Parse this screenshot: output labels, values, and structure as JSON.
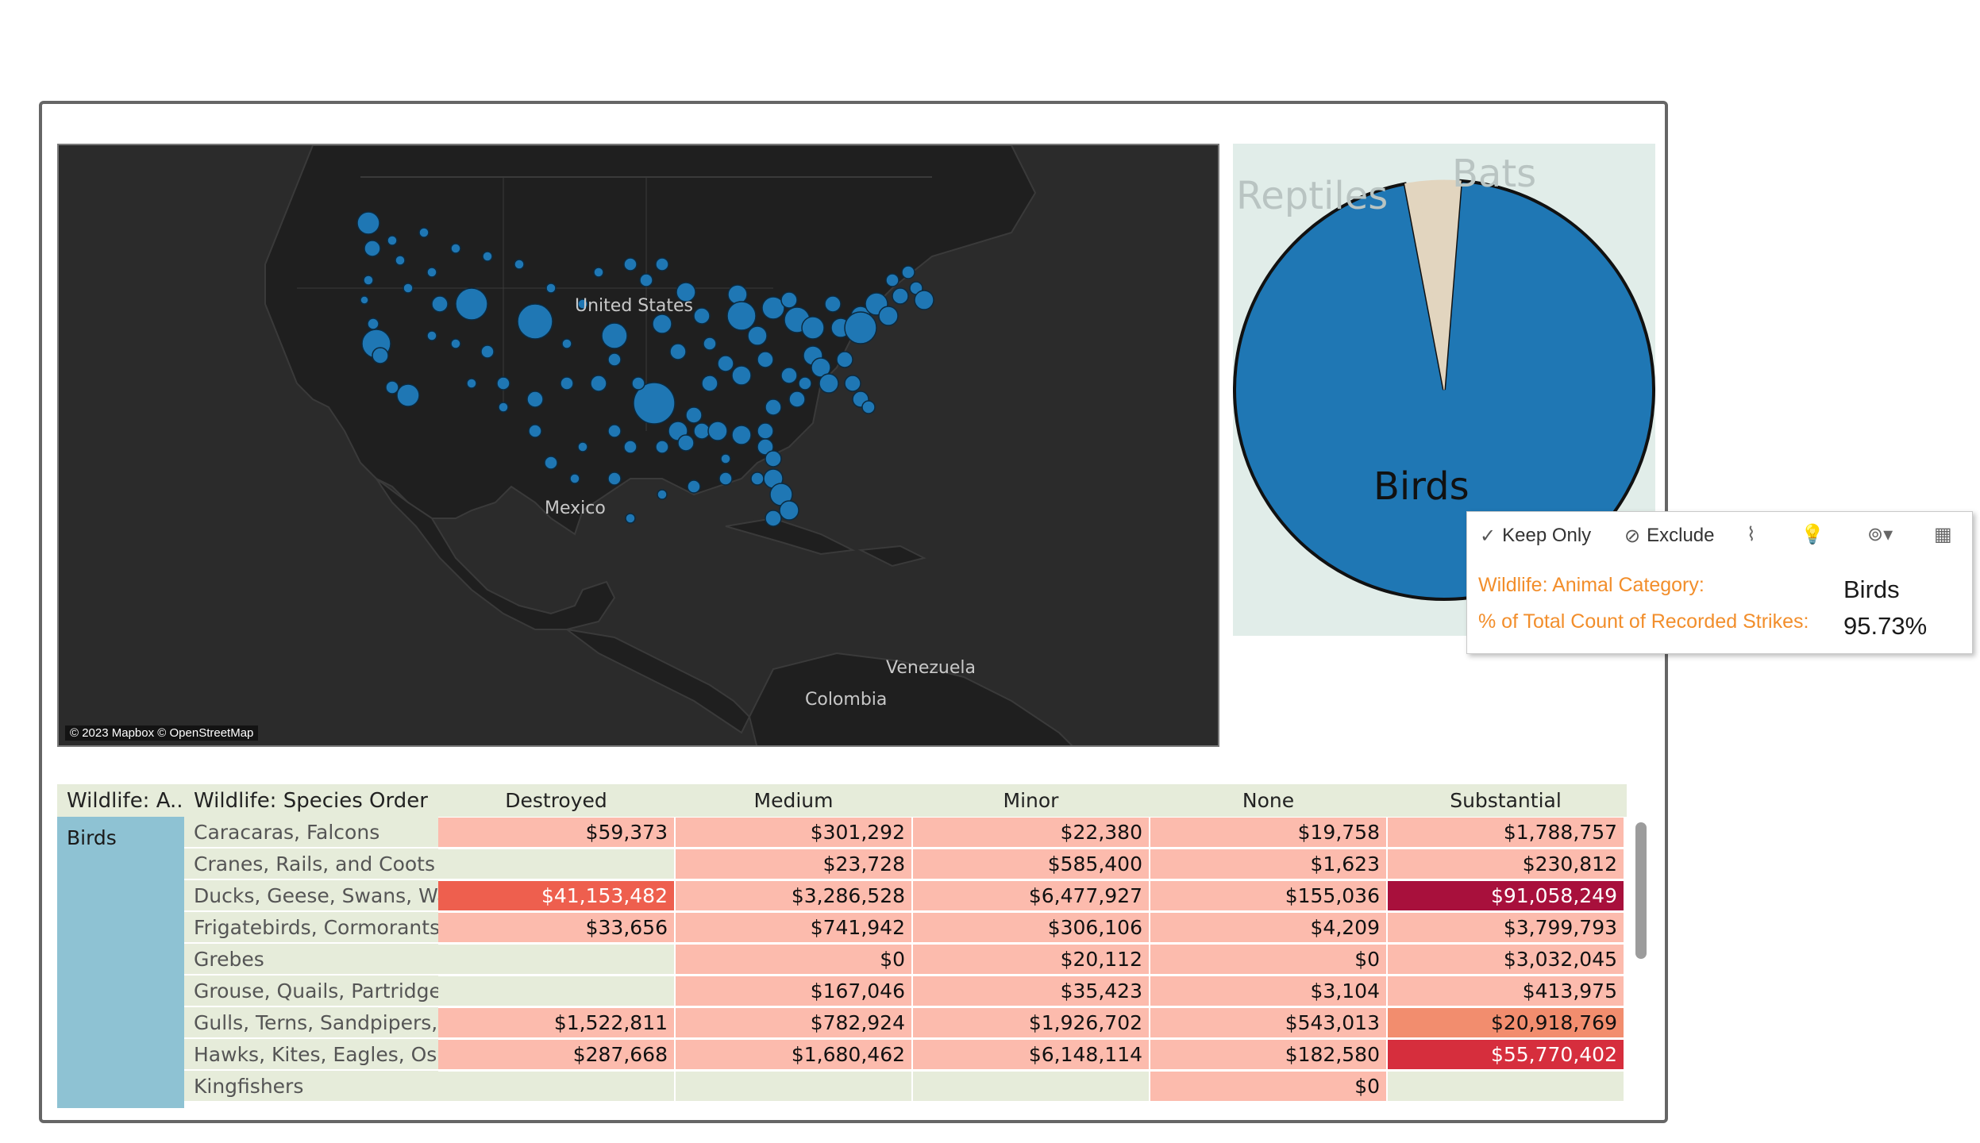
{
  "map": {
    "labels": [
      "United States",
      "Mexico",
      "Venezuela",
      "Colombia"
    ],
    "attribution": "© 2023 Mapbox © OpenStreetMap",
    "point_color": "#1f77b4"
  },
  "pie": {
    "slices": [
      {
        "label": "Birds",
        "percent": 95.73,
        "color": "#1f77b4"
      },
      {
        "label": "Bats",
        "percent": 3.2,
        "color": "#e2d5bf"
      },
      {
        "label": "Reptiles",
        "percent": 1.07,
        "color": "#e2d5bf"
      }
    ]
  },
  "tooltip": {
    "keep_only": "Keep Only",
    "exclude": "Exclude",
    "field1_label": "Wildlife: Animal Category:",
    "field1_value": "Birds",
    "field2_label": "% of Total Count of Recorded Strikes:",
    "field2_value": "95.73%"
  },
  "table": {
    "headers": {
      "col1": "Wildlife: A..",
      "col2": "Wildlife: Species Order",
      "damage": [
        "Destroyed",
        "Medium",
        "Minor",
        "None",
        "Substantial"
      ]
    },
    "category": "Birds",
    "rows": [
      {
        "order": "Caracaras, Falcons",
        "values": [
          "$59,373",
          "$301,292",
          "$22,380",
          "$19,758",
          "$1,788,757"
        ]
      },
      {
        "order": "Cranes, Rails, and Coots",
        "values": [
          "",
          "$23,728",
          "$585,400",
          "$1,623",
          "$230,812"
        ]
      },
      {
        "order": "Ducks, Geese, Swans, Wa..",
        "values": [
          "$41,153,482",
          "$3,286,528",
          "$6,477,927",
          "$155,036",
          "$91,058,249"
        ]
      },
      {
        "order": "Frigatebirds, Cormorants,..",
        "values": [
          "$33,656",
          "$741,942",
          "$306,106",
          "$4,209",
          "$3,799,793"
        ]
      },
      {
        "order": "Grebes",
        "values": [
          "",
          "$0",
          "$20,112",
          "$0",
          "$3,032,045"
        ]
      },
      {
        "order": "Grouse, Quails, Partridge..",
        "values": [
          "",
          "$167,046",
          "$35,423",
          "$3,104",
          "$413,975"
        ]
      },
      {
        "order": "Gulls, Terns, Sandpipers, ..",
        "values": [
          "$1,522,811",
          "$782,924",
          "$1,926,702",
          "$543,013",
          "$20,918,769"
        ]
      },
      {
        "order": "Hawks, Kites, Eagles, Osp..",
        "values": [
          "$287,668",
          "$1,680,462",
          "$6,148,114",
          "$182,580",
          "$55,770,402"
        ]
      },
      {
        "order": "Kingfishers",
        "values": [
          "",
          "",
          "",
          "$0",
          ""
        ]
      }
    ],
    "colors": {
      "empty": "#e6ecda",
      "low": "#fcbbad",
      "mid_high": "#f28d6e",
      "high": "#ee5f4e",
      "higher": "#d62e3d",
      "highest": "#a8103c"
    }
  }
}
